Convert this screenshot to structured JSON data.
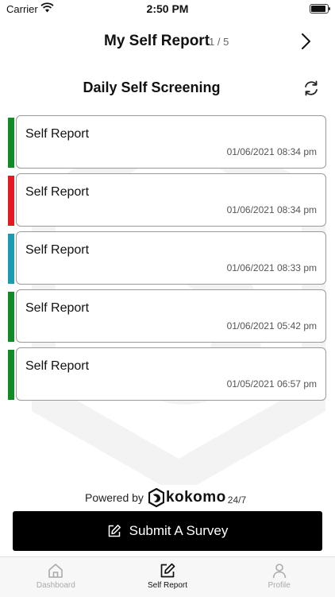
{
  "status_bar": {
    "carrier": "Carrier",
    "time": "2:50 PM",
    "battery_level": 1.0
  },
  "header": {
    "title": "My Self Report",
    "counter": "1 / 5"
  },
  "section": {
    "title": "Daily Self Screening"
  },
  "reports": [
    {
      "title": "Self Report",
      "timestamp": "01/06/2021 08:34 pm",
      "status_color": "#138a25"
    },
    {
      "title": "Self Report",
      "timestamp": "01/06/2021 08:34 pm",
      "status_color": "#e21b23"
    },
    {
      "title": "Self Report",
      "timestamp": "01/06/2021 08:33 pm",
      "status_color": "#1b9bb0"
    },
    {
      "title": "Self Report",
      "timestamp": "01/06/2021 05:42 pm",
      "status_color": "#138a25"
    },
    {
      "title": "Self Report",
      "timestamp": "01/05/2021 06:57 pm",
      "status_color": "#138a25"
    }
  ],
  "footer": {
    "powered_by": "Powered by",
    "brand_name": "kokomo",
    "brand_suffix": "24/7"
  },
  "submit": {
    "label": "Submit A Survey"
  },
  "tabs": [
    {
      "label": "Dashboard",
      "icon": "home-icon",
      "active": false
    },
    {
      "label": "Self Report",
      "icon": "edit-icon",
      "active": true
    },
    {
      "label": "Profile",
      "icon": "person-icon",
      "active": false
    }
  ]
}
